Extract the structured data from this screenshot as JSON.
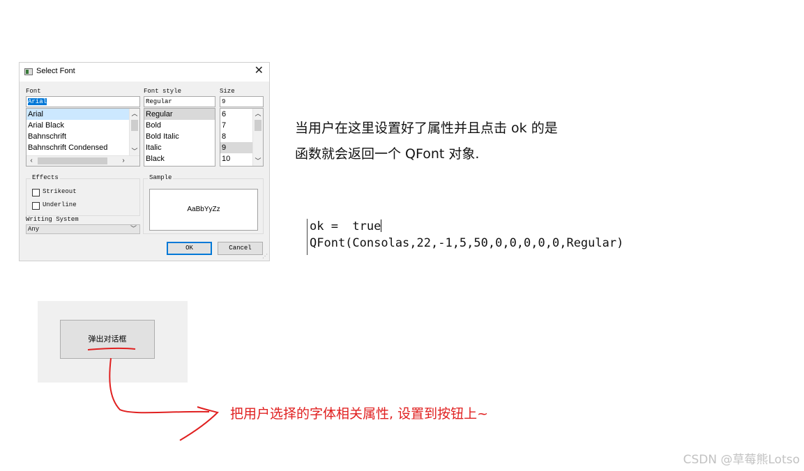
{
  "dialog": {
    "title": "Select Font",
    "close_glyph": "✕",
    "font_label": "Font",
    "font_value": "Arial",
    "font_list": [
      "Arial",
      "Arial Black",
      "Bahnschrift",
      "Bahnschrift Condensed"
    ],
    "style_label": "Font style",
    "style_value": "Regular",
    "style_list": [
      "Regular",
      "Bold",
      "Bold Italic",
      "Italic",
      "Black"
    ],
    "size_label": "Size",
    "size_value": "9",
    "size_list": [
      "6",
      "7",
      "8",
      "9",
      "10"
    ],
    "effects_label": "Effects",
    "strikeout_label": "Strikeout",
    "underline_label": "Underline",
    "sample_label": "Sample",
    "sample_text": "AaBbYyZz",
    "writing_system_label": "Writing System",
    "writing_system_value": "Any",
    "ok_label": "OK",
    "cancel_label": "Cancel"
  },
  "annotation": {
    "line1": "当用户在这里设置好了属性并且点击 ok 的是",
    "line2": "函数就会返回一个 QFont 对象.",
    "code_line1": "ok =  true",
    "code_line2": "QFont(Consolas,22,-1,5,50,0,0,0,0,0,Regular)",
    "demo_button": "弹出对话框",
    "red_note": "把用户选择的字体相关属性, 设置到按钮上~",
    "watermark": "CSDN @草莓熊Lotso"
  },
  "colors": {
    "selection": "#0078d7",
    "list_highlight": "#cce8ff",
    "annotation_red": "#e02020"
  }
}
